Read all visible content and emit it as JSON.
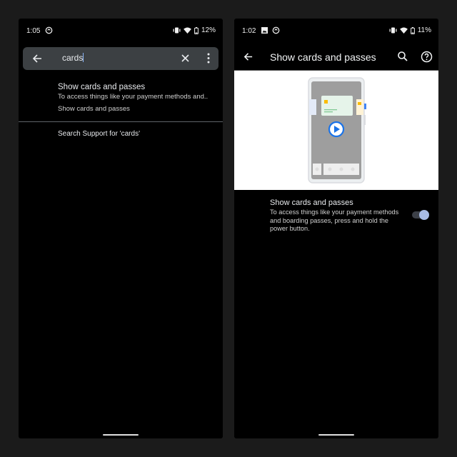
{
  "left_screen": {
    "status_bar": {
      "time": "1:05",
      "battery": "12%",
      "icons": [
        "sync-icon",
        "vibrate-icon",
        "wifi-icon",
        "battery-icon"
      ]
    },
    "search": {
      "query": "cards",
      "icons": [
        "back-arrow-icon",
        "clear-icon",
        "more-vert-icon"
      ]
    },
    "result": {
      "title": "Show cards and passes",
      "description": "To access things like your payment methods and..",
      "path": "Show cards and passes"
    },
    "support_link": "Search Support for 'cards'"
  },
  "right_screen": {
    "status_bar": {
      "time": "1:02",
      "battery": "11%",
      "icons": [
        "image-icon",
        "sync-icon",
        "vibrate-icon",
        "wifi-icon",
        "battery-icon"
      ]
    },
    "app_bar": {
      "title": "Show cards and passes",
      "icons": [
        "back-arrow-icon",
        "search-icon",
        "help-icon"
      ]
    },
    "illustration": {
      "description": "phone with cards and play button",
      "accent": "#1a73e8"
    },
    "setting": {
      "title": "Show cards and passes",
      "description": "To access things like your payment methods and boarding passes, press and hold the power button.",
      "enabled": true
    }
  },
  "colors": {
    "background": "#1b1b1b",
    "searchbar": "#3c4043",
    "toggle_thumb": "#a8bbe3",
    "divider": "#5f6368"
  }
}
